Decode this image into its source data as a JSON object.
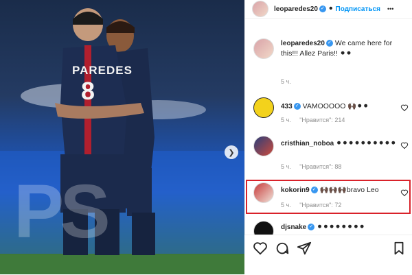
{
  "header": {
    "username": "leoparedes20",
    "follow_label": "Подписаться",
    "more_label": "•••"
  },
  "photo": {
    "jersey_name": "PAREDES",
    "jersey_number": "8",
    "watermark": "PS"
  },
  "caption": {
    "username": "leoparedes20",
    "text": "We came here for this!!! Allez Paris!! ⚫⚫",
    "time": "5 ч."
  },
  "comments": [
    {
      "username": "433",
      "text": "VAMOOOOO 🙌🏿⚫⚫",
      "time": "5 ч.",
      "likes": "\"Нравится\": 214"
    },
    {
      "username": "cristhian_noboa",
      "text": "⚫⚫⚫⚫⚫⚫⚫⚫⚫⚫",
      "time": "5 ч.",
      "likes": "\"Нравится\": 88"
    },
    {
      "username": "kokorin9",
      "text": "🙌🏿🙌🏿🙌🏿bravo Leo",
      "time": "5 ч.",
      "likes": "\"Нравится\": 72"
    },
    {
      "username": "djsnake",
      "text": "⚫⚫⚫⚫⚫⚫⚫⚫"
    }
  ],
  "colors": {
    "accent": "#0095f6",
    "verified": "#3897f0",
    "highlight": "#d9222a"
  }
}
